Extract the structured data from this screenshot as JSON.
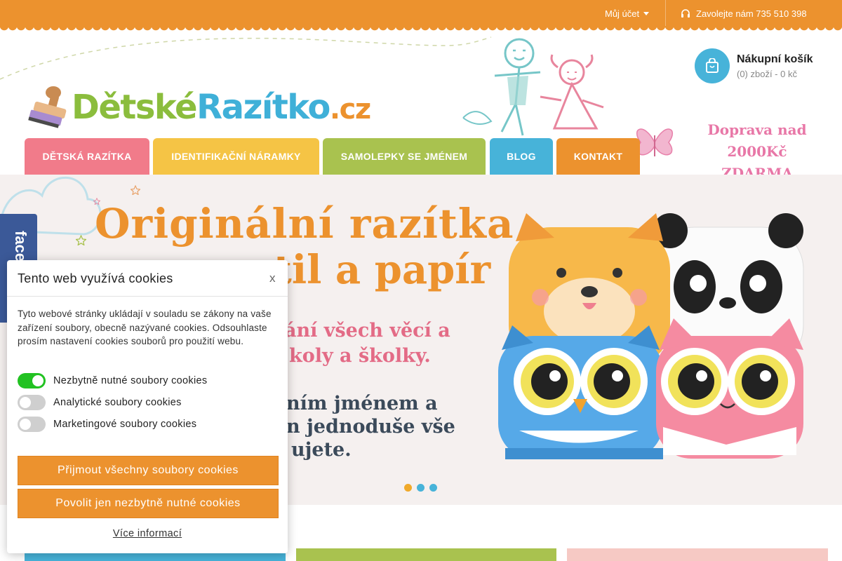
{
  "topbar": {
    "account_label": "Můj účet",
    "phone_label": "Zavolejte nám 735 510 398"
  },
  "logo": {
    "part1": "Dětské",
    "part2": "Razítko",
    "part3": ".cz"
  },
  "cart": {
    "title": "Nákupní košík",
    "summary": "(0) zboží - 0 kč"
  },
  "promo": {
    "line1": "Doprava nad 2000Kč",
    "line2": "ZDARMA"
  },
  "nav": {
    "items": [
      {
        "label": "DĚTSKÁ RAZÍTKA",
        "color": "#f17b8a"
      },
      {
        "label": "IDENTIFIKAČNÍ NÁRAMKY",
        "color": "#f5c445"
      },
      {
        "label": "SAMOLEPKY SE JMÉNEM",
        "color": "#a9c24f"
      },
      {
        "label": "BLOG",
        "color": "#47b3d9"
      },
      {
        "label": "KONTAKT",
        "color": "#ec922e"
      }
    ]
  },
  "hero": {
    "headline_line1": "Originální razítka",
    "headline_line2": "til a papír",
    "pink_line1": "ání všech věcí a",
    "pink_line2": "koly a školky.",
    "dark_line1": "ním jménem a",
    "dark_line2": "n jednoduše vše",
    "dark_line3": "ujete.",
    "slides_total": 3,
    "active_slide": 1
  },
  "facebook": {
    "label": "facebook"
  },
  "cookie": {
    "title": "Tento web využívá cookies",
    "close": "x",
    "description": "Tyto webové stránky ukládají v souladu se zákony na vaše zařízení soubory, obecně nazývané cookies. Odsouhlaste prosím nastavení cookies souborů pro použití webu.",
    "options": [
      {
        "label": "Nezbytně nutné soubory cookies",
        "enabled": true
      },
      {
        "label": "Analytické soubory cookies",
        "enabled": false
      },
      {
        "label": "Marketingové soubory cookies",
        "enabled": false
      }
    ],
    "accept_all": "Přijmout všechny soubory cookies",
    "accept_necessary": "Povolit jen nezbytně nutné cookies",
    "more_info": "Více informací"
  },
  "colors": {
    "orange": "#ec922e",
    "blue": "#47b3d9",
    "green": "#8bbd3d",
    "pink": "#e36b86"
  }
}
